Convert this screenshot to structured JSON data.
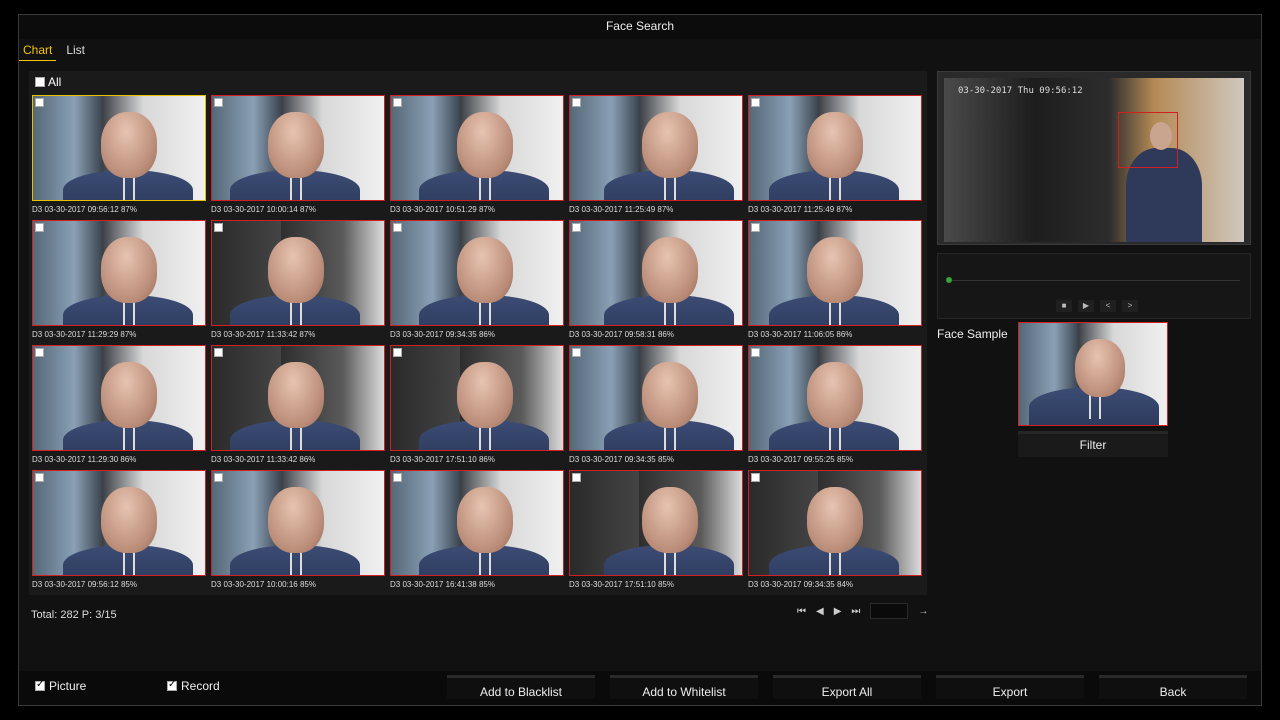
{
  "window": {
    "title": "Face Search"
  },
  "tabs": [
    {
      "label": "Chart",
      "active": true
    },
    {
      "label": "List",
      "active": false
    }
  ],
  "select_all": {
    "label": "All",
    "checked": false
  },
  "results": [
    {
      "caption": "D3 03-30-2017 09:56:12  87%",
      "selected": true,
      "dark": false
    },
    {
      "caption": "D3 03-30-2017 10:00:14  87%",
      "selected": false,
      "dark": false
    },
    {
      "caption": "D3 03-30-2017 10:51:29  87%",
      "selected": false,
      "dark": false
    },
    {
      "caption": "D3 03-30-2017 11:25:49  87%",
      "selected": false,
      "dark": false
    },
    {
      "caption": "D3 03-30-2017 11:25:49  87%",
      "selected": false,
      "dark": false
    },
    {
      "caption": "D3 03-30-2017 11:29:29  87%",
      "selected": false,
      "dark": false
    },
    {
      "caption": "D3 03-30-2017 11:33:42  87%",
      "selected": false,
      "dark": true
    },
    {
      "caption": "D3 03-30-2017 09:34:35  86%",
      "selected": false,
      "dark": false
    },
    {
      "caption": "D3 03-30-2017 09:58:31  86%",
      "selected": false,
      "dark": false
    },
    {
      "caption": "D3 03-30-2017 11:06:05  86%",
      "selected": false,
      "dark": false
    },
    {
      "caption": "D3 03-30-2017 11:29:30  86%",
      "selected": false,
      "dark": false
    },
    {
      "caption": "D3 03-30-2017 11:33:42  86%",
      "selected": false,
      "dark": true
    },
    {
      "caption": "D3 03-30-2017 17:51:10  86%",
      "selected": false,
      "dark": true
    },
    {
      "caption": "D3 03-30-2017 09:34:35  85%",
      "selected": false,
      "dark": false
    },
    {
      "caption": "D3 03-30-2017 09:55:25  85%",
      "selected": false,
      "dark": false
    },
    {
      "caption": "D3 03-30-2017 09:56:12  85%",
      "selected": false,
      "dark": false
    },
    {
      "caption": "D3 03-30-2017 10:00:16  85%",
      "selected": false,
      "dark": false
    },
    {
      "caption": "D3 03-30-2017 16:41:38  85%",
      "selected": false,
      "dark": false
    },
    {
      "caption": "D3 03-30-2017 17:51:10  85%",
      "selected": false,
      "dark": true
    },
    {
      "caption": "D3 03-30-2017 09:34:35  84%",
      "selected": false,
      "dark": true
    }
  ],
  "summary": {
    "text": "Total: 282  P: 3/15"
  },
  "pager": {
    "first_icon": "first-page-icon",
    "prev_icon": "prev-page-icon",
    "next_icon": "next-page-icon",
    "last_icon": "last-page-icon",
    "go_icon": "go-arrow-icon",
    "page_input_value": ""
  },
  "preview": {
    "timestamp": "03-30-2017 Thu 09:56:12"
  },
  "playback": {
    "controls": [
      "■",
      "▶",
      "<",
      ">"
    ]
  },
  "face_sample": {
    "label": "Face Sample"
  },
  "filter_button": {
    "label": "Filter"
  },
  "options": {
    "picture": {
      "label": "Picture",
      "checked": true
    },
    "record": {
      "label": "Record",
      "checked": true
    }
  },
  "actions": {
    "blacklist": "Add to Blacklist",
    "whitelist": "Add to Whitelist",
    "export_all": "Export All",
    "export": "Export",
    "back": "Back"
  },
  "colors": {
    "accent": "#f5c400",
    "detect_box": "#d21f1f",
    "progress": "#3da13d"
  }
}
